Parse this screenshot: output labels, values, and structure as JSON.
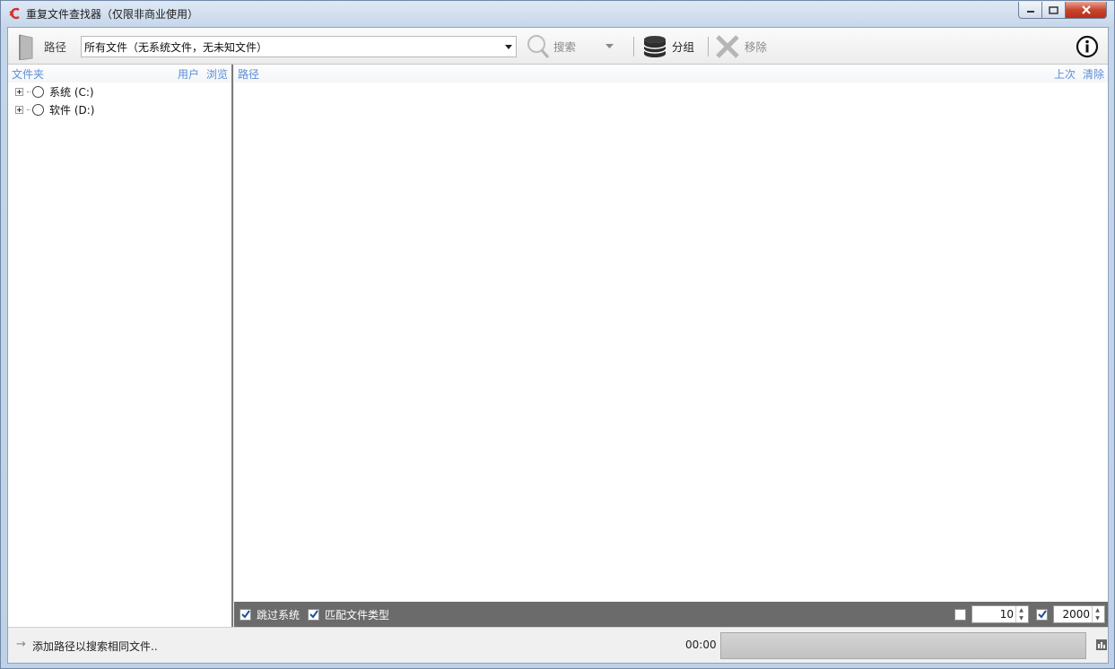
{
  "window": {
    "title": "重复文件查找器（仅限非商业使用）"
  },
  "toolbar": {
    "path_label": "路径",
    "path_combo_value": "所有文件（无系统文件，无未知文件）",
    "search_label": "搜索",
    "group_label": "分组",
    "remove_label": "移除"
  },
  "left_pane": {
    "header": "文件夹",
    "user_link": "用户",
    "browse_link": "浏览",
    "drives": [
      {
        "label": "系统 (C:)"
      },
      {
        "label": "软件 (D:)"
      }
    ]
  },
  "right_pane": {
    "header": "路径",
    "last_link": "上次",
    "clear_link": "清除"
  },
  "options": {
    "skip_system_label": "跳过系统",
    "skip_system_checked": true,
    "match_type_label": "匹配文件类型",
    "match_type_checked": true,
    "min_enabled": false,
    "min_value": "10",
    "max_enabled": true,
    "max_value": "2000"
  },
  "status": {
    "message": "添加路径以搜索相同文件..",
    "elapsed": "00:00",
    "progress": 0
  },
  "colors": {
    "link": "#5b8fd6",
    "strip": "#6b6b6b",
    "close_button": "#c8452d"
  }
}
